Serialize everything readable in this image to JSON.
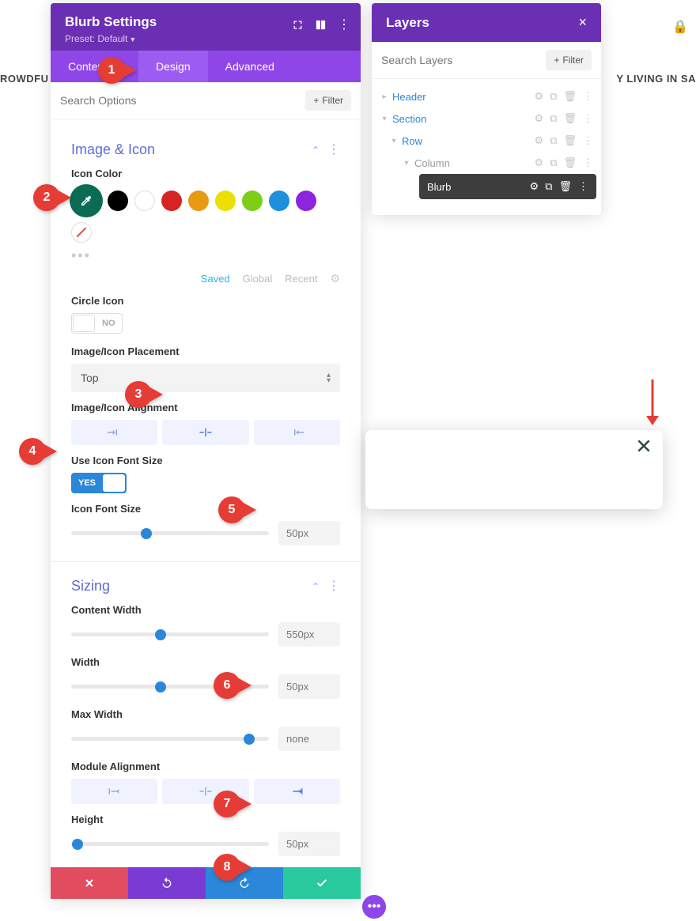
{
  "bg": {
    "left": "ROWDFU",
    "right": "Y LIVING IN SA"
  },
  "settings": {
    "title": "Blurb Settings",
    "preset": "Preset: Default",
    "tabs": {
      "content": "Content",
      "design": "Design",
      "advanced": "Advanced"
    },
    "search_placeholder": "Search Options",
    "filter_label": "Filter",
    "sections": {
      "image_icon": {
        "title": "Image & Icon",
        "icon_color_label": "Icon Color",
        "swatches": {
          "selected": "#0b6b55",
          "colors": [
            "#000000",
            "#ffffff",
            "#d62424",
            "#e89a12",
            "#ede000",
            "#7cce16",
            "#1d8fdb",
            "#8c24e0"
          ]
        },
        "palette_tabs": {
          "saved": "Saved",
          "global": "Global",
          "recent": "Recent"
        },
        "circle_icon_label": "Circle Icon",
        "circle_icon_value": "NO",
        "placement_label": "Image/Icon Placement",
        "placement_value": "Top",
        "alignment_label": "Image/Icon Alignment",
        "use_font_size_label": "Use Icon Font Size",
        "use_font_size_value": "YES",
        "font_size_label": "Icon Font Size",
        "font_size_value": "50px",
        "font_size_pct": 38
      },
      "sizing": {
        "title": "Sizing",
        "content_width_label": "Content Width",
        "content_width_value": "550px",
        "content_width_pct": 45,
        "width_label": "Width",
        "width_value": "50px",
        "width_pct": 45,
        "max_width_label": "Max Width",
        "max_width_value": "none",
        "max_width_pct": 90,
        "module_align_label": "Module Alignment",
        "height_label": "Height",
        "height_value": "50px",
        "height_pct": 3
      }
    }
  },
  "layers": {
    "title": "Layers",
    "search_placeholder": "Search Layers",
    "filter_label": "Filter",
    "items": {
      "header": "Header",
      "section": "Section",
      "row": "Row",
      "column": "Column",
      "blurb": "Blurb"
    }
  },
  "callouts": {
    "c1": "1",
    "c2": "2",
    "c3": "3",
    "c4": "4",
    "c5": "5",
    "c6": "6",
    "c7": "7",
    "c8": "8"
  }
}
